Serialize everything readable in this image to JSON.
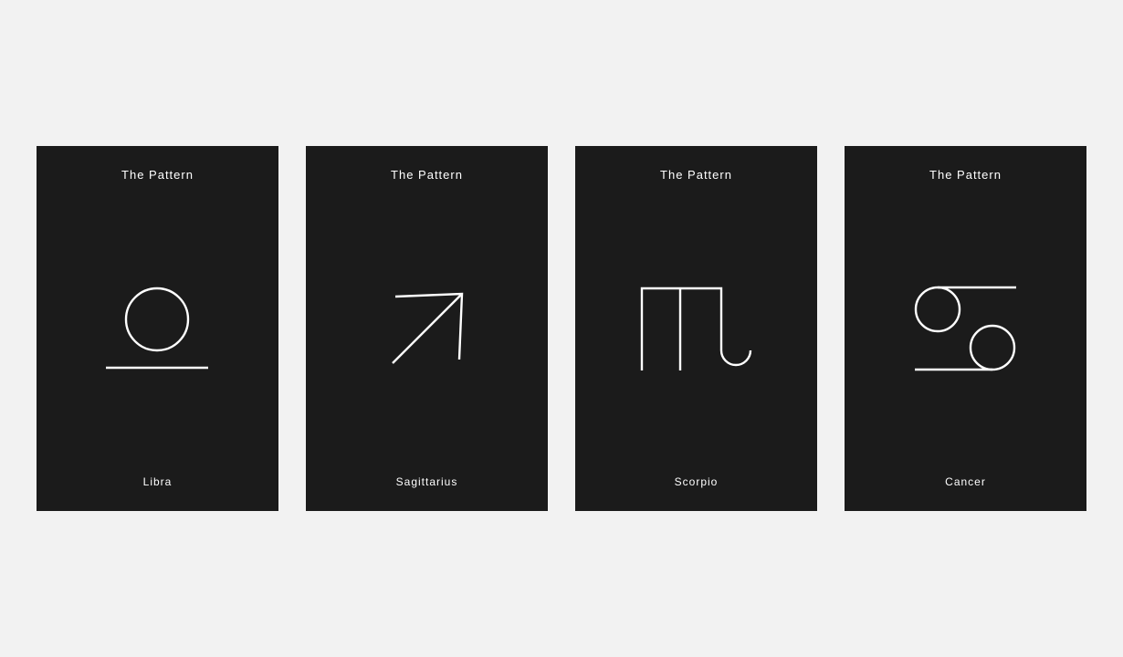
{
  "colors": {
    "page_background": "#f2f2f2",
    "card_background": "#1b1b1b",
    "foreground": "#ffffff"
  },
  "cards": [
    {
      "title": "The Pattern",
      "name": "Libra",
      "icon": "libra-symbol-icon"
    },
    {
      "title": "The Pattern",
      "name": "Sagittarius",
      "icon": "sagittarius-symbol-icon"
    },
    {
      "title": "The Pattern",
      "name": "Scorpio",
      "icon": "scorpio-symbol-icon"
    },
    {
      "title": "The Pattern",
      "name": "Cancer",
      "icon": "cancer-symbol-icon"
    }
  ]
}
